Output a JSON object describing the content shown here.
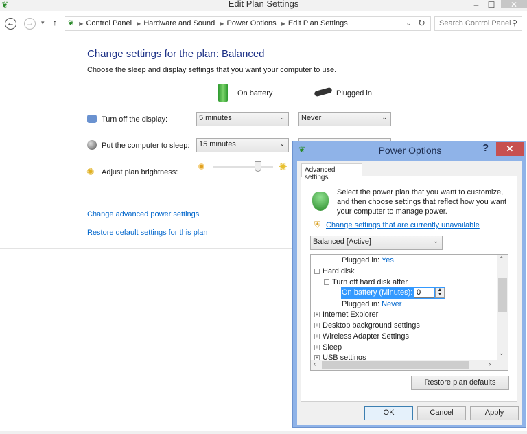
{
  "window": {
    "title": "Edit Plan Settings",
    "minimize": "–",
    "maximize": "☐",
    "close": "✕"
  },
  "nav": {
    "back": "←",
    "forward": "→",
    "recent": "▾",
    "up": "↑",
    "dropdown": "⌄",
    "refresh": "↻",
    "breadcrumb": [
      "Control Panel",
      "Hardware and Sound",
      "Power Options",
      "Edit Plan Settings"
    ],
    "search_placeholder": "Search Control Panel",
    "search_icon": "⚲"
  },
  "main": {
    "heading": "Change settings for the plan: Balanced",
    "subheading": "Choose the sleep and display settings that you want your computer to use.",
    "col_battery": "On battery",
    "col_plugged": "Plugged in",
    "rows": [
      {
        "label": "Turn off the display:",
        "battery": "5 minutes",
        "plugged": "Never"
      },
      {
        "label": "Put the computer to sleep:",
        "battery": "15 minutes",
        "plugged": ""
      }
    ],
    "brightness_label": "Adjust plan brightness:",
    "brightness_level": 0.75,
    "link_advanced": "Change advanced power settings",
    "link_restore": "Restore default settings for this plan"
  },
  "dialog": {
    "title": "Power Options",
    "help": "?",
    "close": "✕",
    "tab": "Advanced settings",
    "intro": "Select the power plan that you want to customize, and then choose settings that reflect how you want your computer to manage power.",
    "change_link": "Change settings that are currently unavailable",
    "plan_select": "Balanced [Active]",
    "tree": {
      "plugged_prev_label": "Plugged in:",
      "plugged_prev_value": "Yes",
      "hard_disk": "Hard disk",
      "turn_off": "Turn off hard disk after",
      "on_battery_label": "On battery (Minutes):",
      "on_battery_value": "0",
      "plugged_label": "Plugged in:",
      "plugged_value": "Never",
      "items": [
        "Internet Explorer",
        "Desktop background settings",
        "Wireless Adapter Settings",
        "Sleep",
        "USB settings"
      ]
    },
    "restore": "Restore plan defaults",
    "ok": "OK",
    "cancel": "Cancel",
    "apply": "Apply"
  }
}
